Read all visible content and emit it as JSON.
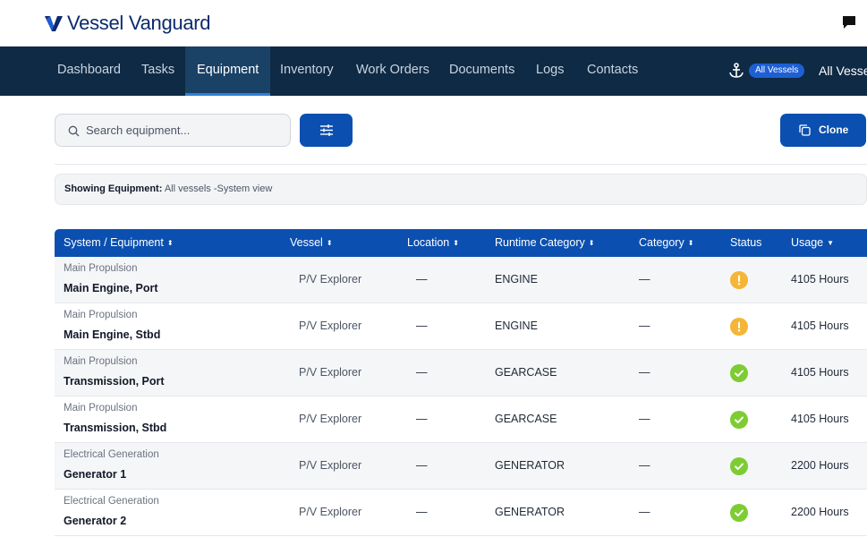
{
  "brand": {
    "name": "Vessel Vanguard"
  },
  "nav": {
    "items": [
      {
        "label": "Dashboard"
      },
      {
        "label": "Tasks"
      },
      {
        "label": "Equipment"
      },
      {
        "label": "Inventory"
      },
      {
        "label": "Work Orders"
      },
      {
        "label": "Documents"
      },
      {
        "label": "Logs"
      },
      {
        "label": "Contacts"
      }
    ],
    "active": "Equipment",
    "vessel_pill": "All Vessels",
    "vessel_selector": "All Vesse"
  },
  "toolbar": {
    "search_placeholder": "Search equipment...",
    "clone_label": "Clone"
  },
  "showing": {
    "label": "Showing Equipment:",
    "value": "All vessels -System view"
  },
  "table": {
    "columns": [
      {
        "label": "System / Equipment",
        "sort": "⬍"
      },
      {
        "label": "Vessel",
        "sort": "⬍"
      },
      {
        "label": "Location",
        "sort": "⬍"
      },
      {
        "label": "Runtime Category",
        "sort": "⬍"
      },
      {
        "label": "Category",
        "sort": "⬍"
      },
      {
        "label": "Status",
        "sort": ""
      },
      {
        "label": "Usage",
        "sort": "▼"
      }
    ],
    "rows": [
      {
        "system": "Main Propulsion",
        "equipment": "Main Engine, Port",
        "vessel": "P/V Explorer",
        "location": "—",
        "runtime_category": "ENGINE",
        "category": "—",
        "status": "warning",
        "usage": "4105 Hours"
      },
      {
        "system": "Main Propulsion",
        "equipment": "Main Engine, Stbd",
        "vessel": "P/V Explorer",
        "location": "—",
        "runtime_category": "ENGINE",
        "category": "—",
        "status": "warning",
        "usage": "4105 Hours"
      },
      {
        "system": "Main Propulsion",
        "equipment": "Transmission, Port",
        "vessel": "P/V Explorer",
        "location": "—",
        "runtime_category": "GEARCASE",
        "category": "—",
        "status": "ok",
        "usage": "4105 Hours"
      },
      {
        "system": "Main Propulsion",
        "equipment": "Transmission, Stbd",
        "vessel": "P/V Explorer",
        "location": "—",
        "runtime_category": "GEARCASE",
        "category": "—",
        "status": "ok",
        "usage": "4105 Hours"
      },
      {
        "system": "Electrical Generation",
        "equipment": "Generator 1",
        "vessel": "P/V Explorer",
        "location": "—",
        "runtime_category": "GENERATOR",
        "category": "—",
        "status": "ok",
        "usage": "2200 Hours"
      },
      {
        "system": "Electrical Generation",
        "equipment": "Generator 2",
        "vessel": "P/V Explorer",
        "location": "—",
        "runtime_category": "GENERATOR",
        "category": "—",
        "status": "ok",
        "usage": "2200 Hours"
      }
    ]
  },
  "colors": {
    "brand_navy": "#0f2a44",
    "accent_blue": "#0b4fb0",
    "status_warning": "#f5b536",
    "status_ok": "#7dcc34"
  }
}
